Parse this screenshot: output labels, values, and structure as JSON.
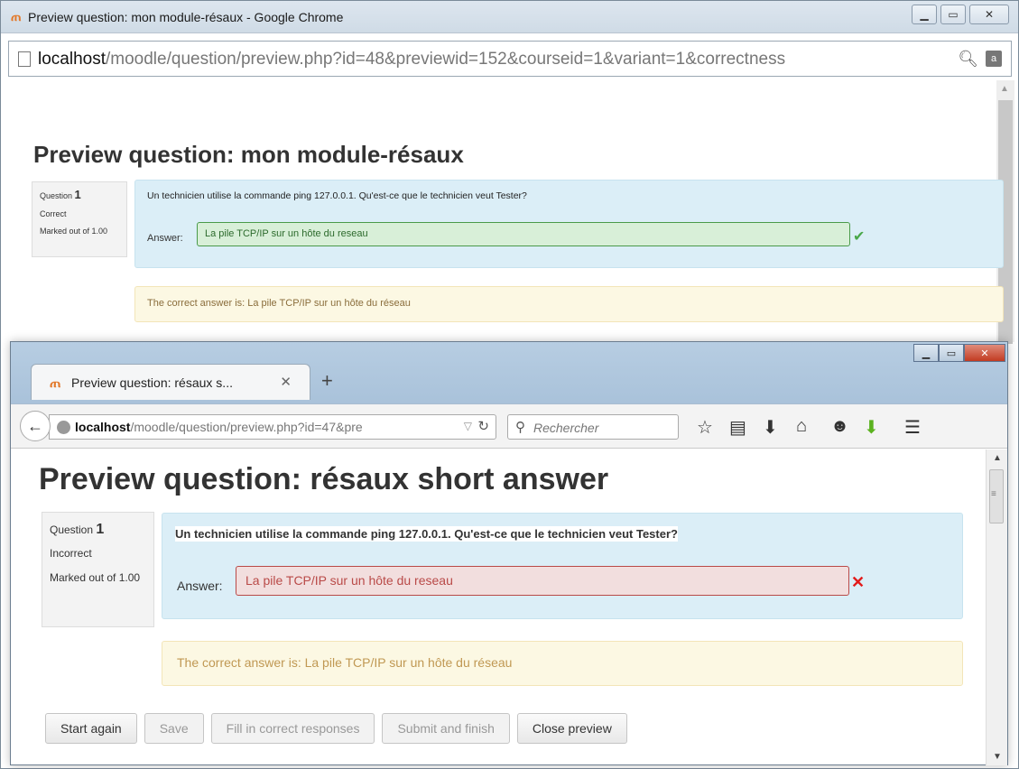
{
  "chrome": {
    "window_title": "Preview question: mon module-résaux - Google Chrome",
    "url_host": "localhost",
    "url_path": "/moodle/question/preview.php?id=48&previewid=152&courseid=1&variant=1&correctness",
    "heading": "Preview question: mon module-résaux",
    "info": {
      "question_label": "Question",
      "question_number": "1",
      "state": "Correct",
      "marked": "Marked out of 1.00"
    },
    "question_text": "Un technicien utilise la commande ping 127.0.0.1. Qu'est-ce que le technicien veut Tester?",
    "answer_label": "Answer:",
    "answer_value": "La pile TCP/IP sur un hôte du reseau",
    "correct_answer": "The correct answer is: La pile TCP/IP sur un hôte du réseau"
  },
  "firefox": {
    "tab_title": "Preview question: résaux s...",
    "url_host": "localhost",
    "url_path": "/moodle/question/preview.php?id=47&pre",
    "search_placeholder": "Rechercher",
    "heading": "Preview question: résaux short answer",
    "info": {
      "question_label": "Question",
      "question_number": "1",
      "state": "Incorrect",
      "marked": "Marked out of 1.00"
    },
    "question_text": "Un technicien utilise la commande ping 127.0.0.1. Qu'est-ce que le technicien veut Tester?",
    "answer_label": "Answer:",
    "answer_value": "La pile TCP/IP sur un hôte du reseau",
    "correct_answer": "The correct answer is: La pile TCP/IP sur un hôte du réseau",
    "buttons": {
      "start_again": "Start again",
      "save": "Save",
      "fill_correct": "Fill in correct responses",
      "submit_finish": "Submit and finish",
      "close_preview": "Close preview"
    }
  },
  "colors": {
    "correct_bg": "#d8efd8",
    "incorrect_bg": "#f2dede",
    "formulation_bg": "#dbeef7",
    "outcome_bg": "#fcf8e3"
  }
}
